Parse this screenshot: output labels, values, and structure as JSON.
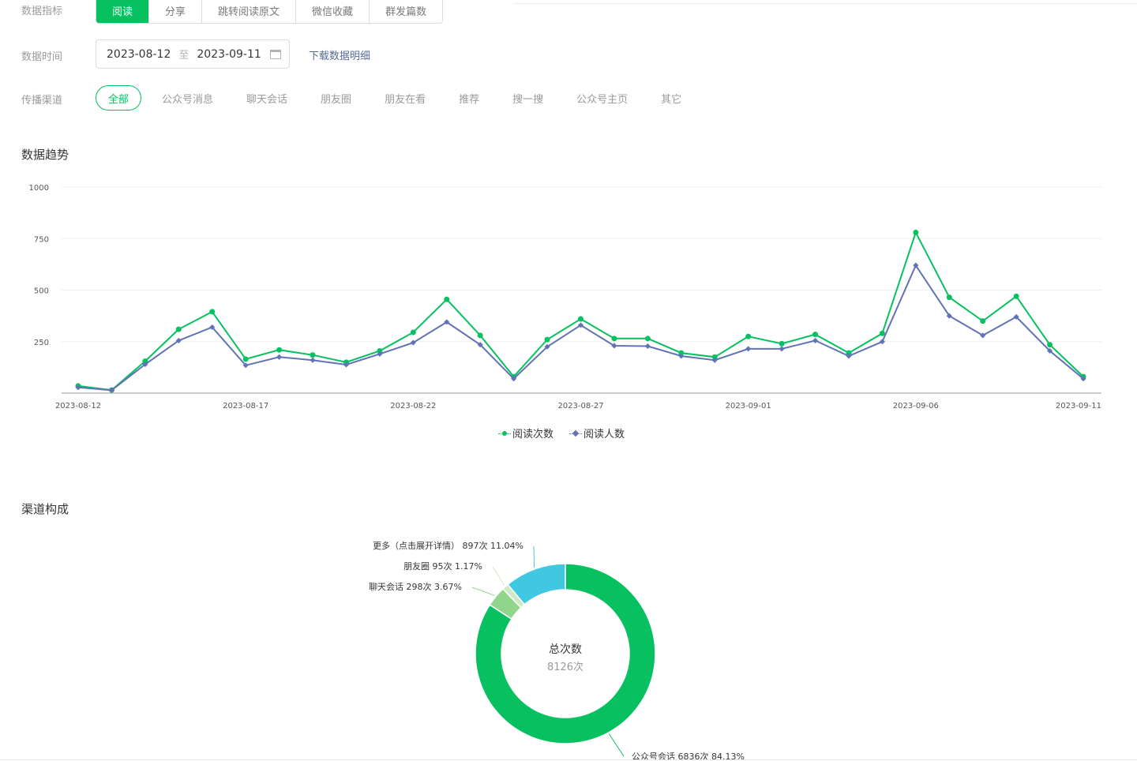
{
  "filters": {
    "metric_label": "数据指标",
    "metrics": [
      "阅读",
      "分享",
      "跳转阅读原文",
      "微信收藏",
      "群发篇数"
    ],
    "active_metric": "阅读",
    "time_label": "数据时间",
    "date_start": "2023-08-12",
    "date_separator": "至",
    "date_end": "2023-09-11",
    "download_link": "下载数据明细",
    "channel_label": "传播渠道",
    "channels": [
      "全部",
      "公众号消息",
      "聊天会话",
      "朋友圈",
      "朋友在看",
      "推荐",
      "搜一搜",
      "公众号主页",
      "其它"
    ],
    "active_channel": "全部"
  },
  "sections": {
    "trend_title": "数据趋势",
    "composition_title": "渠道构成"
  },
  "chart_data": [
    {
      "type": "line",
      "x": [
        "2023-08-12",
        "2023-08-13",
        "2023-08-14",
        "2023-08-15",
        "2023-08-16",
        "2023-08-17",
        "2023-08-18",
        "2023-08-19",
        "2023-08-20",
        "2023-08-21",
        "2023-08-22",
        "2023-08-23",
        "2023-08-24",
        "2023-08-25",
        "2023-08-26",
        "2023-08-27",
        "2023-08-28",
        "2023-08-29",
        "2023-08-30",
        "2023-08-31",
        "2023-09-01",
        "2023-09-02",
        "2023-09-03",
        "2023-09-04",
        "2023-09-05",
        "2023-09-06",
        "2023-09-07",
        "2023-09-08",
        "2023-09-09",
        "2023-09-10",
        "2023-09-11"
      ],
      "x_tick_labels": [
        "2023-08-12",
        "2023-08-17",
        "2023-08-22",
        "2023-08-27",
        "2023-09-01",
        "2023-09-06",
        "2023-09-11"
      ],
      "series": [
        {
          "name": "阅读次数",
          "color": "#07c160",
          "marker": "circle",
          "values": [
            35,
            15,
            155,
            310,
            395,
            165,
            210,
            185,
            150,
            205,
            295,
            455,
            280,
            80,
            260,
            360,
            265,
            265,
            195,
            175,
            275,
            240,
            285,
            195,
            290,
            780,
            465,
            350,
            470,
            235,
            80
          ]
        },
        {
          "name": "阅读人数",
          "color": "#6173b5",
          "marker": "diamond",
          "values": [
            28,
            14,
            140,
            255,
            320,
            135,
            175,
            160,
            138,
            190,
            245,
            345,
            235,
            70,
            225,
            330,
            230,
            228,
            180,
            160,
            215,
            215,
            255,
            180,
            250,
            620,
            375,
            280,
            370,
            205,
            70
          ]
        }
      ],
      "y_ticks": [
        250,
        500,
        750,
        1000
      ],
      "ylim": [
        0,
        1000
      ],
      "grid": true,
      "legend_position": "bottom-center"
    },
    {
      "type": "pie",
      "donut": true,
      "center_title": "总次数",
      "center_value": "8126次",
      "slices": [
        {
          "label": "公众号会话",
          "value": 6836,
          "value_text": "6836次",
          "percent": "84.13%",
          "color": "#07c160"
        },
        {
          "label": "聊天会话",
          "value": 298,
          "value_text": "298次",
          "percent": "3.67%",
          "color": "#91d48b"
        },
        {
          "label": "朋友圈",
          "value": 95,
          "value_text": "95次",
          "percent": "1.17%",
          "color": "#cfe9c5"
        },
        {
          "label": "更多（点击展开详情）",
          "value": 897,
          "value_text": "897次",
          "percent": "11.04%",
          "color": "#40c8e0"
        }
      ]
    }
  ]
}
